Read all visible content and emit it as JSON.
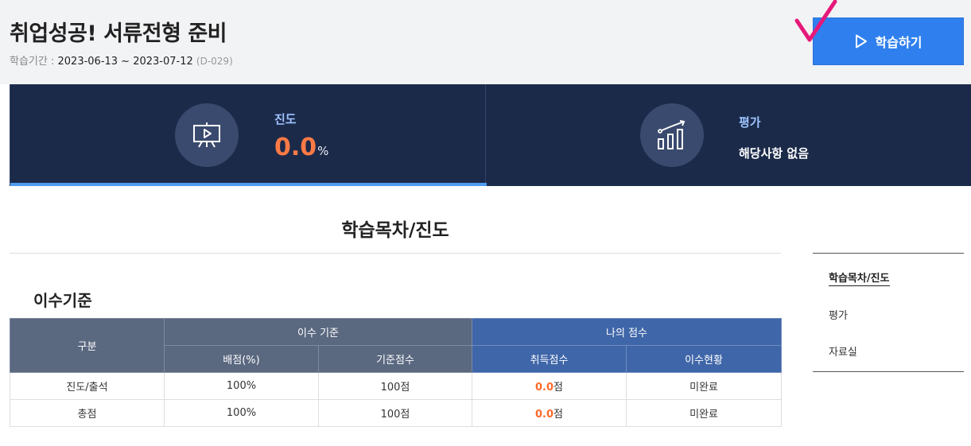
{
  "header": {
    "title": "취업성공! 서류전형 준비",
    "period_label": "학습기간 : ",
    "period_dates": "2023-06-13 ~ 2023-07-12",
    "dday": "(D-029)",
    "study_button_label": "학습하기",
    "check_mark_color": "#e6197a"
  },
  "stats": {
    "progress": {
      "label": "진도",
      "value": "0.0",
      "unit": "%",
      "value_color": "#ff7a45"
    },
    "evaluation": {
      "label": "평가",
      "value": "해당사항 없음"
    }
  },
  "main": {
    "section_title": "학습목차/진도",
    "criteria_heading": "이수기준",
    "table": {
      "header_category": "구분",
      "group_completion": "이수 기준",
      "group_my_score": "나의 점수",
      "col_weight": "배점(%)",
      "col_base_score": "기준점수",
      "col_earned_score": "취득점수",
      "col_status": "이수현황",
      "rows": [
        {
          "category": "진도/출석",
          "weight": "100%",
          "base": "100점",
          "earned": "0.0",
          "earned_unit": "점",
          "status": "미완료"
        },
        {
          "category": "총점",
          "weight": "100%",
          "base": "100점",
          "earned": "0.0",
          "earned_unit": "점",
          "status": "미완료"
        }
      ]
    }
  },
  "side_nav": {
    "items": [
      {
        "label": "학습목차/진도",
        "active": true
      },
      {
        "label": "평가",
        "active": false
      },
      {
        "label": "자료실",
        "active": false
      }
    ]
  },
  "colors": {
    "header_bg": "#f2f3f5",
    "button_blue": "#2f80ee",
    "stats_bg": "#1c2a4a",
    "table_header_gray": "#5a6880",
    "table_header_blue": "#3f66a8",
    "score_orange": "#ff6a2a"
  }
}
